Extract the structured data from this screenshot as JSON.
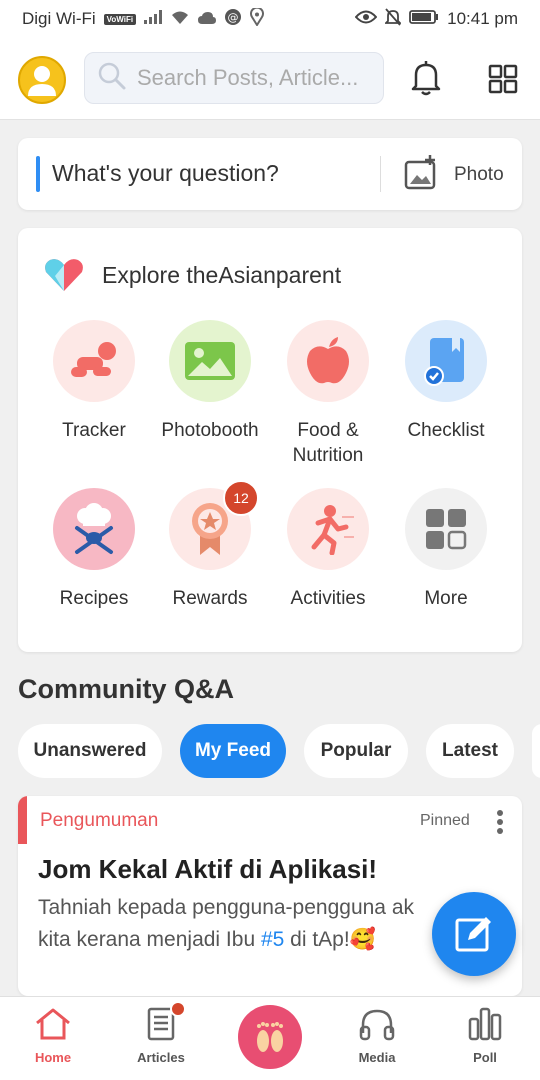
{
  "status_bar": {
    "carrier": "Digi Wi-Fi",
    "volte": "VoWiFi",
    "time": "10:41 pm"
  },
  "header": {
    "search_placeholder": "Search Posts, Article..."
  },
  "question": {
    "prompt": "What's your question?",
    "photo_label": "Photo"
  },
  "explore": {
    "title": "Explore theAsianparent",
    "tiles": [
      {
        "label": "Tracker",
        "icon": "baby-crawl-icon",
        "bg": "#fde8e6"
      },
      {
        "label": "Photobooth",
        "icon": "image-icon",
        "bg": "#e4f4cf"
      },
      {
        "label": "Food &\nNutrition",
        "icon": "apple-icon",
        "bg": "#fde8e6"
      },
      {
        "label": "Checklist",
        "icon": "checklist-icon",
        "bg": "#dcebfb"
      },
      {
        "label": "Recipes",
        "icon": "chef-hat-icon",
        "bg": "#f7b8c4"
      },
      {
        "label": "Rewards",
        "icon": "medal-icon",
        "bg": "#fde8e6",
        "badge": "12"
      },
      {
        "label": "Activities",
        "icon": "running-icon",
        "bg": "#fde8e6"
      },
      {
        "label": "More",
        "icon": "more-grid-icon",
        "bg": "#f1f1f1"
      }
    ]
  },
  "community": {
    "title": "Community Q&A",
    "filters": [
      {
        "label": "Unanswered",
        "active": false
      },
      {
        "label": "My Feed",
        "active": true
      },
      {
        "label": "Popular",
        "active": false
      },
      {
        "label": "Latest",
        "active": false
      }
    ]
  },
  "post": {
    "category": "Pengumuman",
    "pinned": "Pinned",
    "title": "Jom Kekal Aktif di Aplikasi!",
    "body_line1": "Tahniah kepada pengguna-pengguna ak",
    "body_line2_pre": "kita kerana menjadi Ibu ",
    "body_tag": "#5",
    "body_line2_post": " di tAp!🥰"
  },
  "bottom_nav": {
    "items": [
      {
        "label": "Home",
        "active": true
      },
      {
        "label": "Articles",
        "active": false
      },
      {
        "label": "Media",
        "active": false
      },
      {
        "label": "Poll",
        "active": false
      }
    ]
  },
  "colors": {
    "accent_blue": "#1f86ef",
    "accent_red": "#e9565a",
    "badge_red": "#d4462c"
  }
}
